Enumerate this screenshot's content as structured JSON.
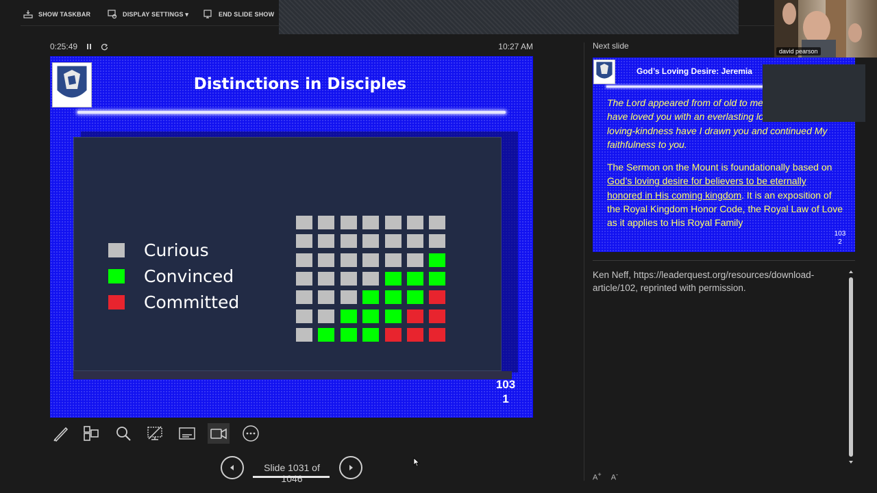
{
  "toolbar": {
    "show_taskbar": "SHOW TASKBAR",
    "display_settings": "DISPLAY SETTINGS ▾",
    "end_slide_show": "END SLIDE SHOW"
  },
  "webcam": {
    "name": "david pearson"
  },
  "presenter": {
    "elapsed_time": "0:25:49",
    "clock": "10:27 AM"
  },
  "current_slide": {
    "title": "Distinctions in Disciples",
    "legend": [
      {
        "label": "Curious",
        "color": "#bfbfbf"
      },
      {
        "label": "Convinced",
        "color": "#00ff00"
      },
      {
        "label": "Committed",
        "color": "#e8242e"
      }
    ],
    "grid_rows": [
      [
        "gray",
        "gray",
        "gray",
        "gray",
        "gray",
        "gray",
        "gray"
      ],
      [
        "gray",
        "gray",
        "gray",
        "gray",
        "gray",
        "gray",
        "gray"
      ],
      [
        "gray",
        "gray",
        "gray",
        "gray",
        "gray",
        "gray",
        "green"
      ],
      [
        "gray",
        "gray",
        "gray",
        "gray",
        "green",
        "green",
        "green"
      ],
      [
        "gray",
        "gray",
        "gray",
        "green",
        "green",
        "green",
        "red"
      ],
      [
        "gray",
        "gray",
        "green",
        "green",
        "green",
        "red",
        "red"
      ],
      [
        "gray",
        "green",
        "green",
        "green",
        "red",
        "red",
        "red"
      ]
    ],
    "number_line1": "103",
    "number_line2": "1"
  },
  "navigation": {
    "counter": "Slide 1031 of 1046"
  },
  "next_slide": {
    "label": "Next slide",
    "title": "God’s Loving Desire: Jeremia",
    "quote": "The Lord appeared from of old to me, saying, Yes, I have loved you with an everlasting love; therefore with loving-kindness have I drawn you and continued My faithfulness to you.",
    "body_pre": "The Sermon on the Mount is foundationally based on ",
    "body_link": "God’s loving desire for believers to be eternally honored in His coming kingdom",
    "body_post": ". It is an exposition of the Royal Kingdom Honor Code, the Royal Law of Love as it applies to His Royal Family",
    "number_line1": "103",
    "number_line2": "2"
  },
  "notes": {
    "text": "Ken Neff, https://leaderquest.org/resources/download-article/102, reprinted with permission."
  },
  "font_size": {
    "increase": "A",
    "decrease": "A"
  },
  "colors": {
    "slide_blue": "#1212f0",
    "panel": "#222b45",
    "quote_yellow": "#ffff66"
  }
}
